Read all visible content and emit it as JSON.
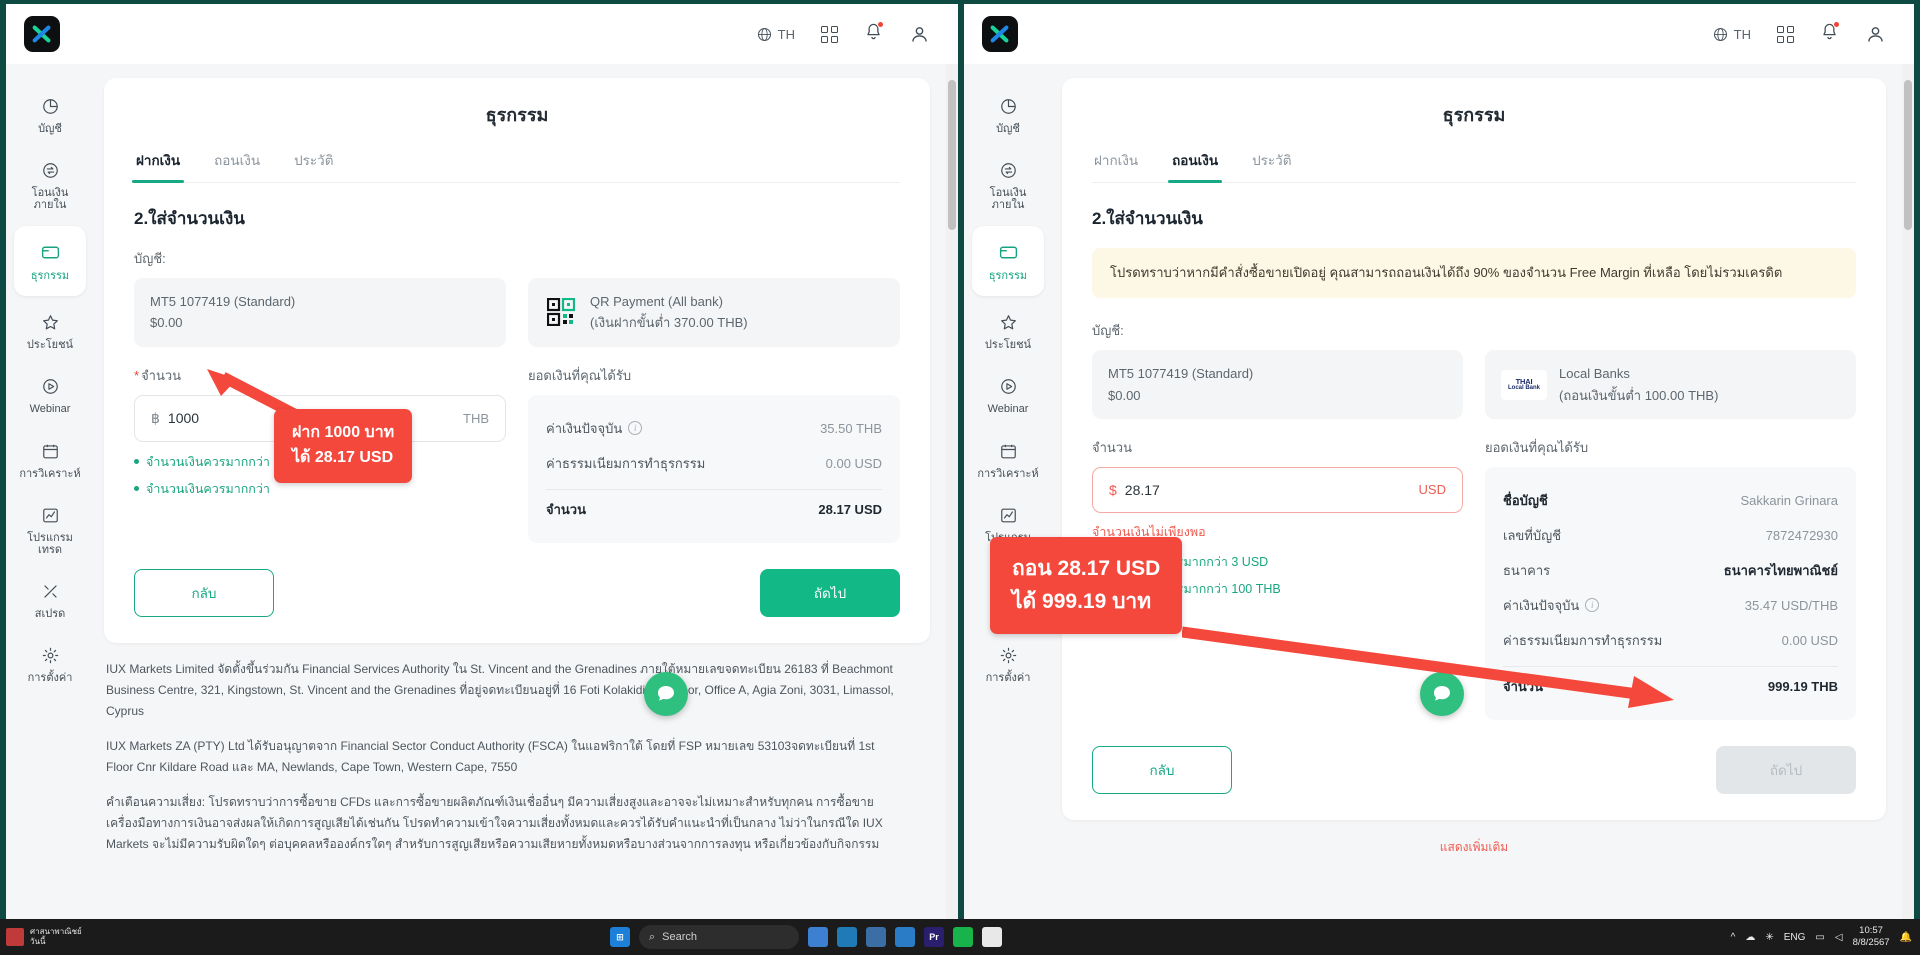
{
  "appbar": {
    "lang": "TH",
    "globe_icon": "globe-icon",
    "apps_icon": "apps-grid-icon",
    "bell_icon": "bell-icon",
    "user_icon": "user-avatar-icon"
  },
  "sidebar": {
    "items": [
      {
        "label": "บัญชี",
        "icon": "pie-chart-icon"
      },
      {
        "label": "โอนเงินภายใน",
        "icon": "transfer-icon"
      },
      {
        "label": "ธุรกรรม",
        "icon": "card-icon"
      },
      {
        "label": "ประโยชน์",
        "icon": "star-icon"
      },
      {
        "label": "Webinar",
        "icon": "play-circle-icon"
      },
      {
        "label": "การวิเคราะห์",
        "icon": "calendar-icon"
      },
      {
        "label": "โปรแกรมเทรด",
        "icon": "chart-line-icon"
      },
      {
        "label": "สเปรด",
        "icon": "spread-icon"
      },
      {
        "label": "การตั้งค่า",
        "icon": "gear-icon"
      }
    ]
  },
  "left": {
    "card_title": "ธุรกรรม",
    "tabs": [
      {
        "label": "ฝากเงิน",
        "active": true
      },
      {
        "label": "ถอนเงิน",
        "active": false
      },
      {
        "label": "ประวัติ",
        "active": false
      }
    ],
    "step_title": "2.ใส่จำนวนเงิน",
    "account_label": "บัญชี:",
    "account": {
      "line1": "MT5 1077419  (Standard)",
      "line2": "$0.00"
    },
    "method": {
      "name": "QR Payment (All bank)",
      "note": "(เงินฝากขั้นต่ำ 370.00 THB)",
      "icon": "qr-code-icon"
    },
    "amount_label": "จำนวน",
    "amount_required_mark": "*",
    "amount_currency_symbol": "฿",
    "amount_value": "1000",
    "amount_unit": "THB",
    "hints": [
      "จำนวนเงินควรมากกว่า",
      "จำนวนเงินควรมากกว่า"
    ],
    "summary_label": "ยอดเงินที่คุณได้รับ",
    "summary_rows": [
      {
        "label": "ค่าเงินปัจจุบัน",
        "info": true,
        "value": "35.50 THB",
        "bold": false
      },
      {
        "label": "ค่าธรรมเนียมการทำธุรกรรม",
        "info": false,
        "value": "0.00 USD",
        "bold": false
      }
    ],
    "summary_total": {
      "label": "จำนวน",
      "value": "28.17 USD"
    },
    "btn_back": "กลับ",
    "btn_next": "ถัดไป",
    "callout": {
      "line1": "ฝาก 1000 บาท",
      "line2": "ได้ 28.17 USD"
    },
    "legal": [
      "IUX Markets Limited จัดตั้งขึ้นร่วมกัน Financial Services Authority ใน St. Vincent and the Grenadines ภายใต้หมายเลขจดทะเบียน 26183 ที่ Beachmont Business Centre, 321, Kingstown, St. Vincent and the Grenadines ที่อยู่จดทะเบียนอยู่ที่ 16 Foti Kolakidi, 1st Floor, Office A, Agia Zoni, 3031, Limassol, Cyprus",
      "IUX Markets ZA (PTY) Ltd ได้รับอนุญาตจาก Financial Sector Conduct Authority (FSCA) ในแอฟริกาใต้ โดยที่ FSP หมายเลข 53103จดทะเบียนที่ 1st Floor Cnr Kildare Road และ MA, Newlands, Cape Town, Western Cape, 7550",
      "คำเตือนความเสี่ยง: โปรดทราบว่าการซื้อขาย CFDs และการซื้อขายผลิตภัณฑ์เงินเชื่ออื่นๆ มีความเสี่ยงสูงและอาจจะไม่เหมาะสำหรับทุกคน การซื้อขาย เครื่องมือทางการเงินอาจส่งผลให้เกิดการสูญเสียได้เช่นกัน โปรดทำความเข้าใจความเสี่ยงทั้งหมดและควรได้รับคำแนะนำที่เป็นกลาง ไม่ว่าในกรณีใด IUX Markets จะไม่มีความรับผิดใดๆ ต่อบุคคลหรือองค์กรใดๆ สำหรับการสูญเสียหรือความเสียหายทั้งหมดหรือบางส่วนจากการลงทุน หรือเกี่ยวข้องกับกิจกรรม"
    ],
    "legal_links": [
      "26183",
      "53103"
    ]
  },
  "right": {
    "card_title": "ธุรกรรม",
    "tabs": [
      {
        "label": "ฝากเงิน",
        "active": false
      },
      {
        "label": "ถอนเงิน",
        "active": true
      },
      {
        "label": "ประวัติ",
        "active": false
      }
    ],
    "step_title": "2.ใส่จำนวนเงิน",
    "notice": "โปรดทราบว่าหากมีคำสั่งซื้อขายเปิดอยู่ คุณสามารถถอนเงินได้ถึง 90% ของจำนวน Free Margin ที่เหลือ โดยไม่รวมเครดิต",
    "account_label": "บัญชี:",
    "account": {
      "line1": "MT5 1077419  (Standard)",
      "line2": "$0.00"
    },
    "method": {
      "name": "Local Banks",
      "note": "(ถอนเงินขั้นต่ำ 100.00 THB)",
      "icon": "thai-local-bank-icon",
      "chip_line1": "THAI",
      "chip_line2": "Local Bank"
    },
    "amount_label": "จำนวน",
    "amount_currency_symbol": "$",
    "amount_value": "28.17",
    "amount_unit": "USD",
    "error_text": "จำนวนเงินไม่เพียงพอ",
    "hints": [
      "จำนวนเงินควรมากกว่า 3 USD",
      "จำนวนเงินควรมากกว่า 100 THB"
    ],
    "summary_label": "ยอดเงินที่คุณได้รับ",
    "summary_rows": [
      {
        "label": "ชื่อบัญชี",
        "info": false,
        "value": "Sakkarin Grinara",
        "bold": false
      },
      {
        "label": "เลขที่บัญชี",
        "info": false,
        "value": "7872472930",
        "bold": false
      },
      {
        "label": "ธนาคาร",
        "info": false,
        "value": "ธนาคารไทยพาณิชย์",
        "bold": true
      },
      {
        "label": "ค่าเงินปัจจุบัน",
        "info": true,
        "value": "35.47 USD/THB",
        "bold": false
      },
      {
        "label": "ค่าธรรมเนียมการทำธุรกรรม",
        "info": false,
        "value": "0.00 USD",
        "bold": false
      }
    ],
    "summary_total": {
      "label": "จำนวน",
      "value": "999.19 THB"
    },
    "btn_back": "กลับ",
    "btn_next": "ถัดไป",
    "callout": {
      "line1": "ถอน 28.17 USD",
      "line2": "ได้ 999.19 บาท"
    },
    "footer_link": "แสดงเพิ่มเติม"
  },
  "taskbar": {
    "note_line1": "ศาสนาพาณิชย์",
    "note_line2": "วันนี้",
    "search_placeholder": "Search",
    "start_icon": "windows-start-icon",
    "apps": [
      "weather-icon",
      "edge-icon",
      "explorer-icon",
      "store-icon",
      "premiere-icon",
      "line-icon",
      "chrome-icon"
    ],
    "tray": [
      "chevron-up-icon",
      "onedrive-icon",
      "bluetooth-icon"
    ],
    "lang": "ENG",
    "time": "10:57",
    "date": "8/8/2567",
    "notify_icon": "bell-icon"
  }
}
